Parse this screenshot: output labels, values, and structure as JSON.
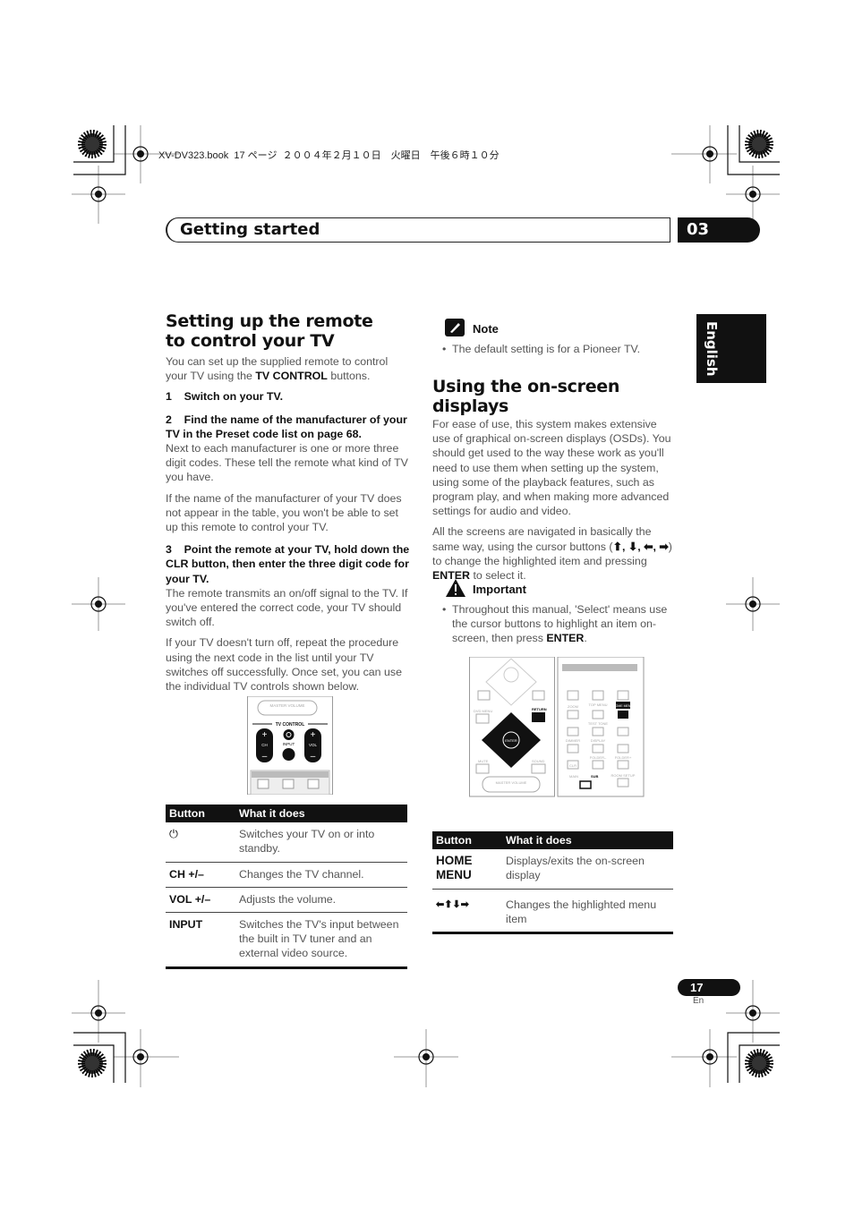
{
  "print_header": "XV-DV323.book  17 ページ  ２００４年２月１０日　火曜日　午後６時１０分",
  "header": {
    "section": "Getting started",
    "chapter": "03",
    "language_tab": "English"
  },
  "left": {
    "title": "Setting up the remote to control your TV",
    "intro_pre": "You can set up the supplied remote to control your TV using the ",
    "intro_bold": "TV CONTROL",
    "intro_post": " buttons.",
    "step1": "1    Switch on your TV.",
    "step2": "2    Find the name of the manufacturer of your TV in the Preset code list on page 68.",
    "p2a": "Next to each manufacturer is one or more three digit codes. These tell the remote what kind of TV you have.",
    "p2b": "If the name of the manufacturer of your TV does not appear in the table, you won't be able to set up this remote to control your TV.",
    "step3": "3    Point the remote at your TV, hold down the CLR button, then enter the three digit code for your TV.",
    "p3a": "The remote transmits an on/off signal to the TV. If you've entered the correct code, your TV should switch off.",
    "p3b": "If your TV doesn't turn off, repeat the procedure using the next code in the list until your TV switches off successfully. Once set, you can use the individual TV controls shown below.",
    "remote": {
      "master_volume": "MASTER VOLUME",
      "tv_control": "TV CONTROL",
      "ch": "CH",
      "input": "INPUT",
      "vol": "VOL"
    },
    "table": {
      "headers": [
        "Button",
        "What it does"
      ],
      "rows": [
        {
          "button": "⏻",
          "icon": "power-icon",
          "desc": "Switches your TV on or into standby."
        },
        {
          "button": "CH +/–",
          "desc": "Changes the TV channel."
        },
        {
          "button": "VOL +/–",
          "desc": "Adjusts the volume."
        },
        {
          "button": "INPUT",
          "desc": "Switches the TV's input between the built in TV tuner and an external video source."
        }
      ]
    }
  },
  "right": {
    "note_title": "Note",
    "note_items": [
      "The default setting is for a Pioneer TV."
    ],
    "title": "Using the on-screen displays",
    "p1": "For ease of use, this system makes extensive use of graphical on-screen displays (OSDs). You should get used to the way these work as you'll need to use them when setting up the system, using some of the playback features, such as program play, and when making more advanced settings for audio and video.",
    "p2_pre": "All the screens are navigated in basically the same way, using the cursor buttons (",
    "p2_arrows": "⬆, ⬇, ⬅, ➡",
    "p2_mid": ") to change the highlighted item and pressing ",
    "p2_bold": "ENTER",
    "p2_post": " to select it.",
    "important_title": "Important",
    "important_pre": "Throughout this manual, 'Select' means use the cursor buttons to highlight an item on-screen, then press ",
    "important_bold": "ENTER",
    "important_post": ".",
    "remote": {
      "dvd_menu": "DVD MENU",
      "return": "RETURN",
      "enter": "ENTER",
      "mute": "MUTE",
      "sound": "SOUND",
      "master_volume": "MASTER VOLUME",
      "home_menu": "HOME MENU",
      "zoom": "ZOOM",
      "top_menu": "TOP MENU",
      "test_tone": "TEST TONE",
      "dimmer": "DIMMER",
      "display": "DISPLAY",
      "folder_minus": "FOLDER–",
      "folder_plus": "FOLDER+",
      "clr": "CLR",
      "room_setup": "ROOM SETUP",
      "main": "MAIN",
      "sub": "SUB"
    },
    "table": {
      "headers": [
        "Button",
        "What it does"
      ],
      "rows": [
        {
          "button": "HOME MENU",
          "desc": "Displays/exits the on-screen display"
        },
        {
          "button": "⬅⬆⬇➡",
          "desc": "Changes the highlighted menu item"
        }
      ]
    }
  },
  "footer": {
    "page": "17",
    "lang": "En"
  }
}
